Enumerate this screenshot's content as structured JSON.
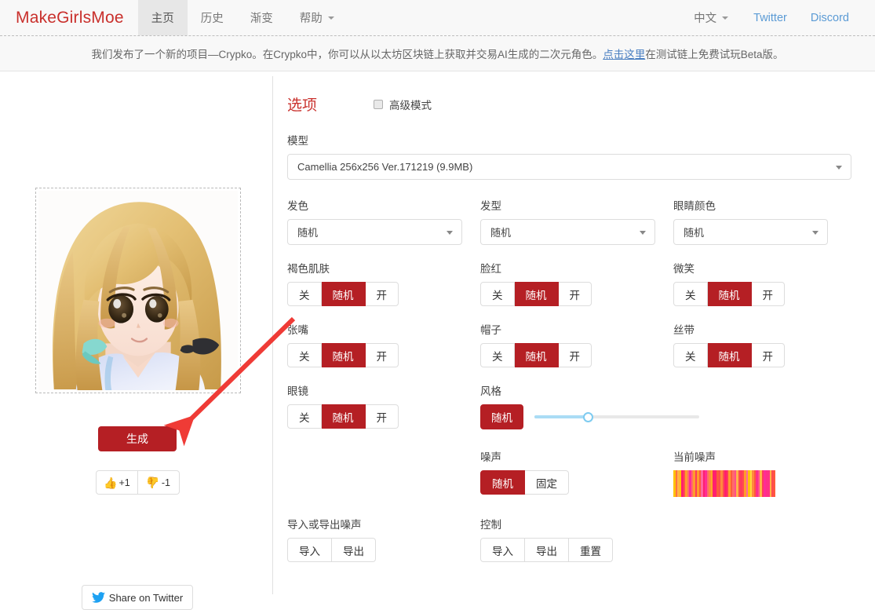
{
  "header": {
    "brand": "MakeGirlsMoe",
    "nav": [
      {
        "label": "主页",
        "active": true
      },
      {
        "label": "历史",
        "active": false
      },
      {
        "label": "渐变",
        "active": false
      },
      {
        "label": "帮助",
        "active": false,
        "caret": true
      }
    ],
    "lang": "中文",
    "links": [
      {
        "label": "Twitter"
      },
      {
        "label": "Discord"
      }
    ]
  },
  "banner": {
    "text_before": "我们发布了一个新的项目—Crypko。在Crypko中，你可以从以太坊区块链上获取并交易AI生成的二次元角色。",
    "link": "点击这里",
    "text_after": "在测试链上免费试玩Beta版。"
  },
  "left": {
    "generate_label": "生成",
    "upvote_label": "+1",
    "downvote_label": "-1",
    "share_label": "Share on Twitter"
  },
  "options": {
    "title": "选项",
    "advanced_label": "高级模式",
    "advanced_checked": false,
    "model": {
      "label": "模型",
      "value": "Camellia 256x256 Ver.171219 (9.9MB)"
    },
    "selects": [
      {
        "label": "发色",
        "value": "随机"
      },
      {
        "label": "发型",
        "value": "随机"
      },
      {
        "label": "眼睛颜色",
        "value": "随机"
      }
    ],
    "toggles": [
      {
        "label": "褐色肌肤",
        "options": [
          "关",
          "随机",
          "开"
        ],
        "selected": 1
      },
      {
        "label": "脸红",
        "options": [
          "关",
          "随机",
          "开"
        ],
        "selected": 1
      },
      {
        "label": "微笑",
        "options": [
          "关",
          "随机",
          "开"
        ],
        "selected": 1
      },
      {
        "label": "张嘴",
        "options": [
          "关",
          "随机",
          "开"
        ],
        "selected": 1
      },
      {
        "label": "帽子",
        "options": [
          "关",
          "随机",
          "开"
        ],
        "selected": 1
      },
      {
        "label": "丝带",
        "options": [
          "关",
          "随机",
          "开"
        ],
        "selected": 1
      },
      {
        "label": "眼镜",
        "options": [
          "关",
          "随机",
          "开"
        ],
        "selected": 1
      }
    ],
    "style": {
      "label": "风格",
      "button": "随机",
      "slider_percent": 33
    },
    "noise": {
      "label": "噪声",
      "options": [
        "随机",
        "固定"
      ],
      "selected": 0
    },
    "current_noise": {
      "label": "当前噪声"
    },
    "noise_io": {
      "label": "导入或导出噪声",
      "options": [
        "导入",
        "导出"
      ]
    },
    "control": {
      "label": "控制",
      "options": [
        "导入",
        "导出",
        "重置"
      ]
    }
  },
  "colors": {
    "brand_red": "#c9302c",
    "active_red": "#b51f24",
    "link_blue": "#5b9bd5",
    "arrow_red": "#ef3b36",
    "slider_blue": "#7ecbf0"
  }
}
